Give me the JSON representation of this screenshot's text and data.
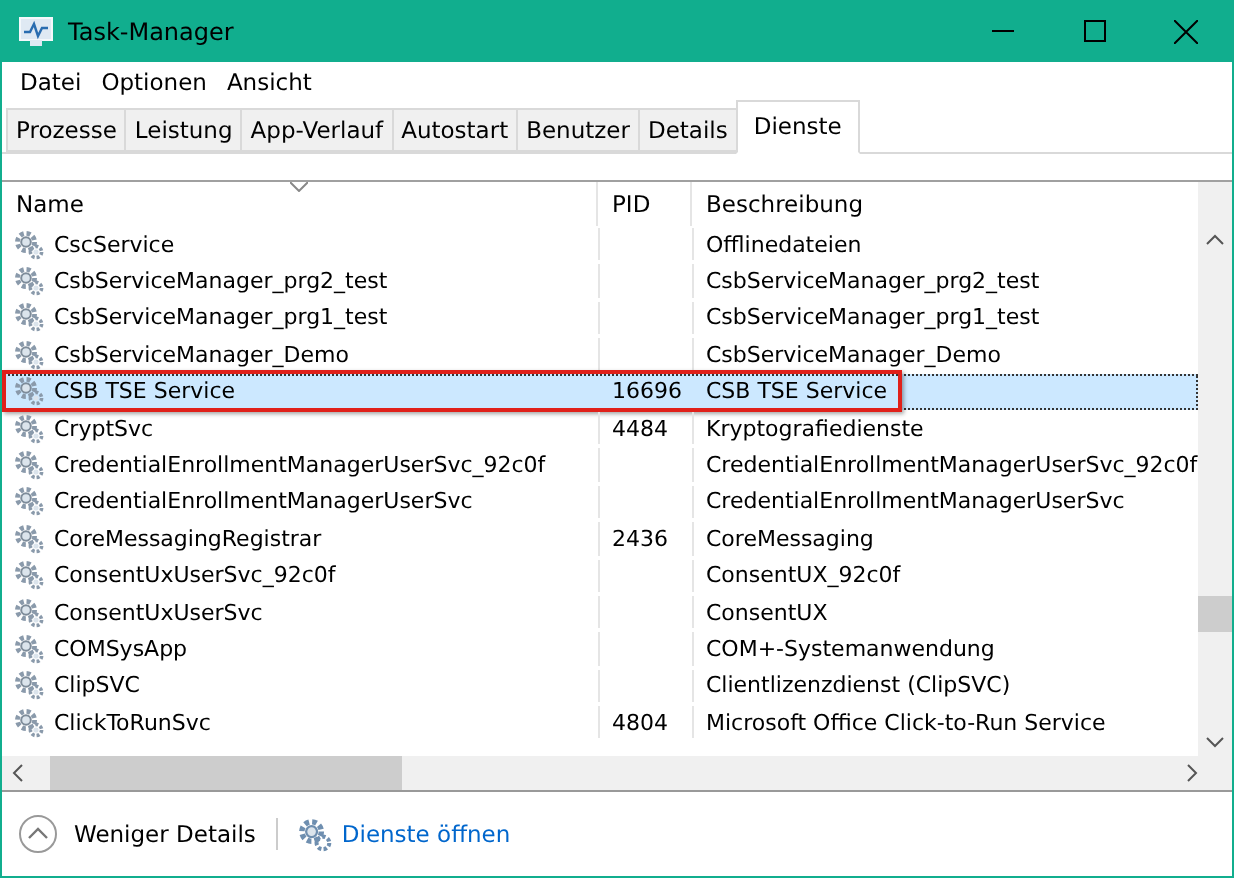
{
  "window": {
    "title": "Task-Manager"
  },
  "menu": [
    "Datei",
    "Optionen",
    "Ansicht"
  ],
  "tabs": [
    {
      "label": "Prozesse",
      "selected": false
    },
    {
      "label": "Leistung",
      "selected": false
    },
    {
      "label": "App-Verlauf",
      "selected": false
    },
    {
      "label": "Autostart",
      "selected": false
    },
    {
      "label": "Benutzer",
      "selected": false
    },
    {
      "label": "Details",
      "selected": false
    },
    {
      "label": "Dienste",
      "selected": true
    }
  ],
  "table": {
    "columns": [
      "Name",
      "PID",
      "Beschreibung"
    ],
    "rows": [
      {
        "name": "CscService",
        "pid": "",
        "description": "Offlinedateien",
        "selected": false,
        "highlighted": false
      },
      {
        "name": "CsbServiceManager_prg2_test",
        "pid": "",
        "description": "CsbServiceManager_prg2_test",
        "selected": false,
        "highlighted": false
      },
      {
        "name": "CsbServiceManager_prg1_test",
        "pid": "",
        "description": "CsbServiceManager_prg1_test",
        "selected": false,
        "highlighted": false
      },
      {
        "name": "CsbServiceManager_Demo",
        "pid": "",
        "description": "CsbServiceManager_Demo",
        "selected": false,
        "highlighted": false
      },
      {
        "name": "CSB TSE Service",
        "pid": "16696",
        "description": "CSB TSE Service",
        "selected": true,
        "highlighted": true
      },
      {
        "name": "CryptSvc",
        "pid": "4484",
        "description": "Kryptografiedienste",
        "selected": false,
        "highlighted": false
      },
      {
        "name": "CredentialEnrollmentManagerUserSvc_92c0f",
        "pid": "",
        "description": "CredentialEnrollmentManagerUserSvc_92c0f",
        "selected": false,
        "highlighted": false
      },
      {
        "name": "CredentialEnrollmentManagerUserSvc",
        "pid": "",
        "description": "CredentialEnrollmentManagerUserSvc",
        "selected": false,
        "highlighted": false
      },
      {
        "name": "CoreMessagingRegistrar",
        "pid": "2436",
        "description": "CoreMessaging",
        "selected": false,
        "highlighted": false
      },
      {
        "name": "ConsentUxUserSvc_92c0f",
        "pid": "",
        "description": "ConsentUX_92c0f",
        "selected": false,
        "highlighted": false
      },
      {
        "name": "ConsentUxUserSvc",
        "pid": "",
        "description": "ConsentUX",
        "selected": false,
        "highlighted": false
      },
      {
        "name": "COMSysApp",
        "pid": "",
        "description": "COM+-Systemanwendung",
        "selected": false,
        "highlighted": false
      },
      {
        "name": "ClipSVC",
        "pid": "",
        "description": "Clientlizenzdienst (ClipSVC)",
        "selected": false,
        "highlighted": false
      },
      {
        "name": "ClickToRunSvc",
        "pid": "4804",
        "description": "Microsoft Office Click-to-Run Service",
        "selected": false,
        "highlighted": false
      }
    ]
  },
  "footer": {
    "fewer_details": "Weniger Details",
    "open_services": "Dienste öffnen"
  }
}
